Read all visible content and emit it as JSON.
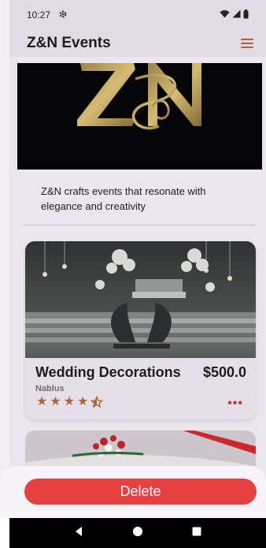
{
  "status_bar": {
    "time": "10:27",
    "icons": [
      "gear-icon",
      "wifi-icon",
      "signal-icon",
      "battery-icon"
    ]
  },
  "app_bar": {
    "title": "Z&N Events",
    "menu_icon": "hamburger-menu-icon"
  },
  "hero": {
    "image": "gold Z&N logo on black background"
  },
  "tagline": "Z&N crafts events that resonate with elegance and creativity",
  "cards": [
    {
      "title": "Wedding Decorations",
      "price": "$500.0",
      "location": "Nablus",
      "rating": 4.5,
      "more_icon": "more-dots-icon"
    }
  ],
  "sheet": {
    "delete_label": "Delete"
  },
  "nav_bar": {
    "icons": [
      "back-icon",
      "home-icon",
      "recents-icon"
    ]
  },
  "colors": {
    "accent": "#b9693f",
    "delete": "#e64141",
    "app_bar": "#efeaf0",
    "background": "#faf6fb"
  }
}
